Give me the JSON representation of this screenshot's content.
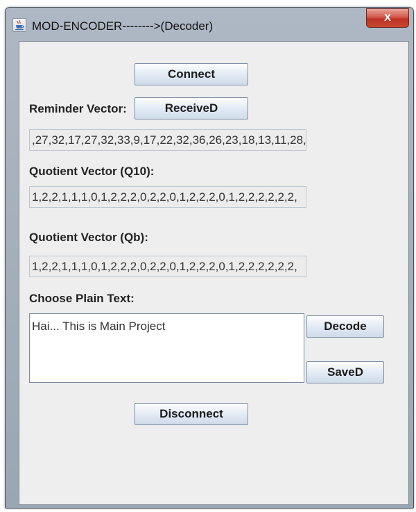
{
  "window": {
    "title": "MOD-ENCODER-------->(Decoder)",
    "close_label": "X"
  },
  "buttons": {
    "connect": "Connect",
    "received": "ReceiveD",
    "decode": "Decode",
    "saved": "SaveD",
    "disconnect": "Disconnect"
  },
  "reminder": {
    "label": "Reminder Vector:",
    "value": ",27,32,17,27,32,33,9,17,22,32,36,26,23,18,13,11,28,"
  },
  "quotient_q10": {
    "label": "Quotient Vector (Q10):",
    "value": "1,2,2,1,1,1,0,1,2,2,2,0,2,2,0,1,2,2,2,0,1,2,2,2,2,2,2,"
  },
  "quotient_qb": {
    "label": "Quotient Vector (Qb):",
    "value": "1,2,2,1,1,1,0,1,2,2,2,0,2,2,0,1,2,2,2,0,1,2,2,2,2,2,2,"
  },
  "plain_text": {
    "label": "Choose Plain Text:",
    "value": "Hai... This is Main Project"
  },
  "icons": {
    "app": "java-coffee-cup-icon",
    "close": "close-icon"
  }
}
